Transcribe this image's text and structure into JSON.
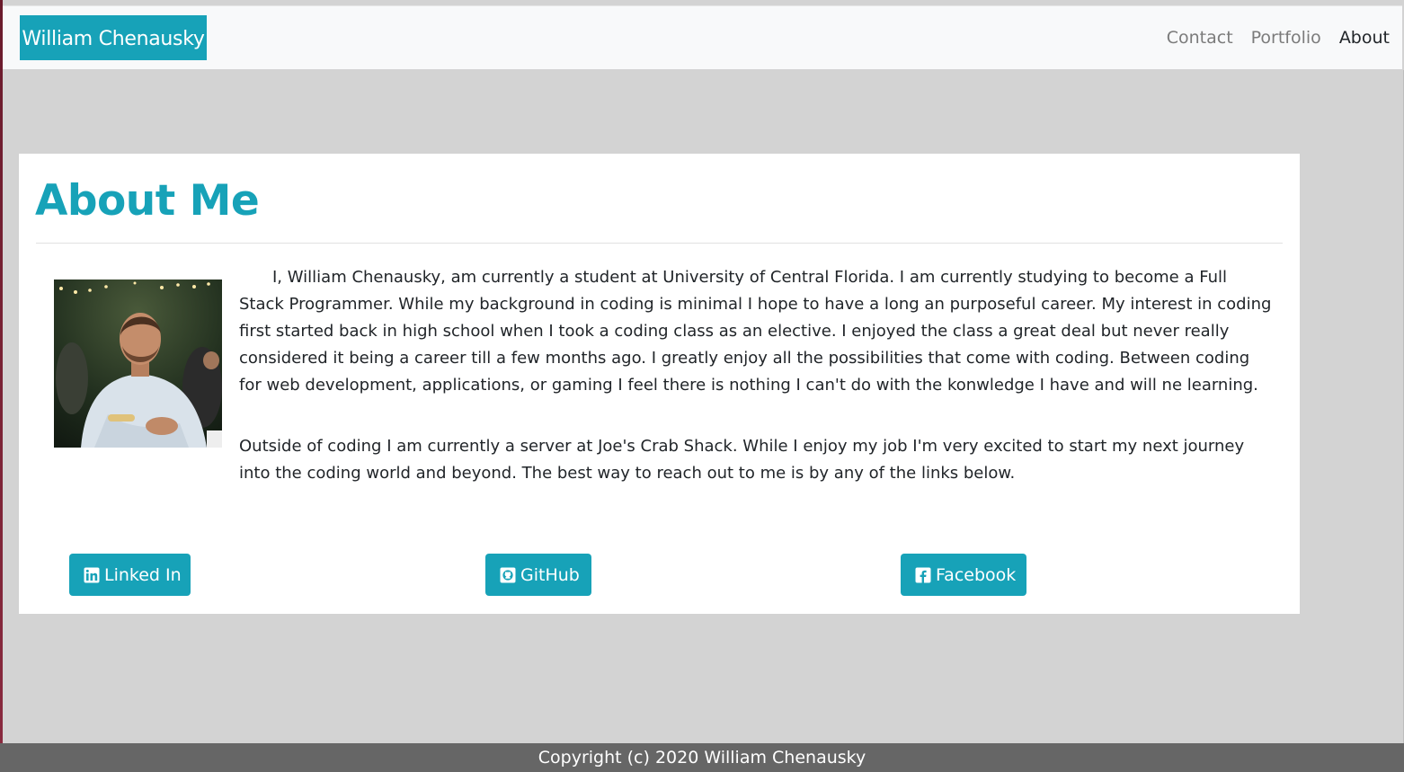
{
  "navbar": {
    "brand": "William Chenausky",
    "links": [
      {
        "label": "Contact",
        "active": false
      },
      {
        "label": "Portfolio",
        "active": false
      },
      {
        "label": "About",
        "active": true
      }
    ]
  },
  "about": {
    "title": "About Me",
    "photo_alt": "William Chenausky",
    "paragraphs": [
      "I, William Chenausky, am currently a student at University of Central Florida. I am currently studying to become a Full Stack Programmer. While my background in coding is minimal I hope to have a long an purposeful career. My interest in coding first started back in high school when I took a coding class as an elective. I enjoyed the class a great deal but never really considered it being a career till a few months ago. I greatly enjoy all the possibilities that come with coding. Between coding for web development, applications, or gaming I feel there is nothing I can't do with the konwledge I have and will ne learning.",
      "Outside of coding I am currently a server at Joe's Crab Shack. While I enjoy my job I'm very excited to start my next journey into the coding world and beyond. The best way to reach out to me is by any of the links below."
    ],
    "buttons": [
      {
        "label": "Linked In",
        "icon": "linkedin-icon"
      },
      {
        "label": "GitHub",
        "icon": "github-icon"
      },
      {
        "label": "Facebook",
        "icon": "facebook-icon"
      }
    ]
  },
  "footer": {
    "copyright": "Copyright (c) 2020 William Chenausky"
  },
  "colors": {
    "accent": "#17a2b8",
    "page_background": "#d3d3d3",
    "footer_background": "#666666",
    "navbar_background": "#f8f9fa"
  }
}
